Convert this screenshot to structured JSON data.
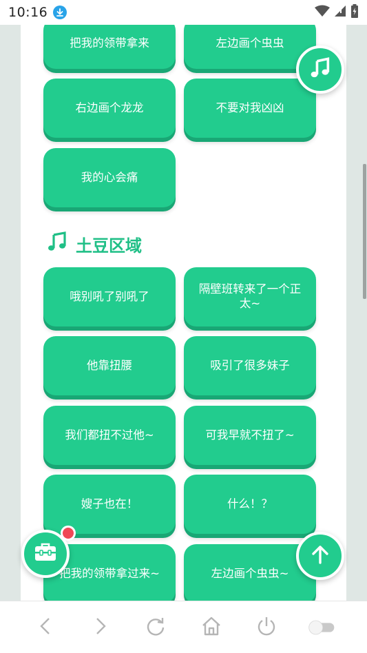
{
  "status_bar": {
    "time": "10:16",
    "icons": [
      "download-icon",
      "wifi-icon",
      "signal-icon",
      "battery-icon"
    ]
  },
  "top_buttons": [
    "把我的领带拿来",
    "左边画个虫虫",
    "右边画个龙龙",
    "不要对我凶凶",
    "我的心会痛"
  ],
  "section": {
    "title": "土豆区域",
    "icon": "music-note-icon"
  },
  "section_buttons": [
    "哦别吼了别吼了",
    "隔壁班转来了一个正太~",
    "他靠扭腰",
    "吸引了很多妹子",
    "我们都扭不过他~",
    "可我早就不扭了~",
    "嫂子也在！",
    "什么！？",
    "把我的领带拿过来~",
    "左边画个虫虫~"
  ],
  "fabs": {
    "music": "music-note-icon",
    "tools": "toolbox-icon",
    "up": "arrow-up-icon"
  },
  "nav": [
    "back-icon",
    "forward-icon",
    "refresh-icon",
    "home-icon",
    "power-icon",
    "toggle-switch"
  ],
  "colors": {
    "accent": "#22cc8e",
    "accent_shadow": "#19a775",
    "badge_red": "#f04856",
    "background": "#dfe7e4"
  }
}
